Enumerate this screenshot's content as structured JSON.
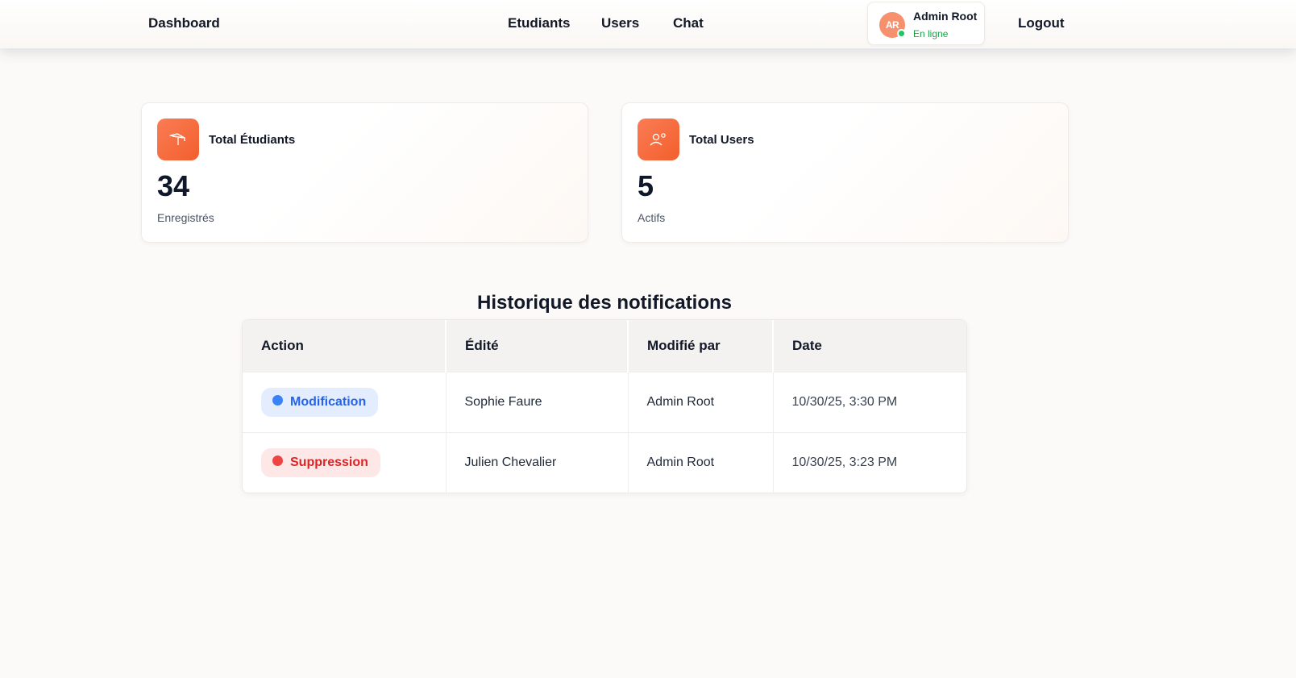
{
  "navbar": {
    "brand": "Dashboard",
    "links": [
      "Etudiants",
      "Users",
      "Chat"
    ],
    "user": {
      "initials": "AR",
      "name": "Admin Root",
      "status": "En ligne"
    },
    "logout": "Logout"
  },
  "stats": [
    {
      "title": "Total Étudiants",
      "value": "34",
      "subtitle": "Enregistrés",
      "icon": "graduation-cap-icon"
    },
    {
      "title": "Total Users",
      "value": "5",
      "subtitle": "Actifs",
      "icon": "users-icon"
    }
  ],
  "notifications": {
    "title": "Historique des notifications",
    "columns": [
      "Action",
      "Édité",
      "Modifié par",
      "Date"
    ],
    "rows": [
      {
        "action": "Modification",
        "action_color": "#2563eb",
        "edited": "Sophie Faure",
        "by": "Admin Root",
        "date": "10/30/25, 3:30 PM"
      },
      {
        "action": "Suppression",
        "action_color": "#dc2626",
        "edited": "Julien Chevalier",
        "by": "Admin Root",
        "date": "10/30/25, 3:23 PM"
      }
    ]
  },
  "colors": {
    "accent": "#f25f2c",
    "online": "#22c55e"
  }
}
